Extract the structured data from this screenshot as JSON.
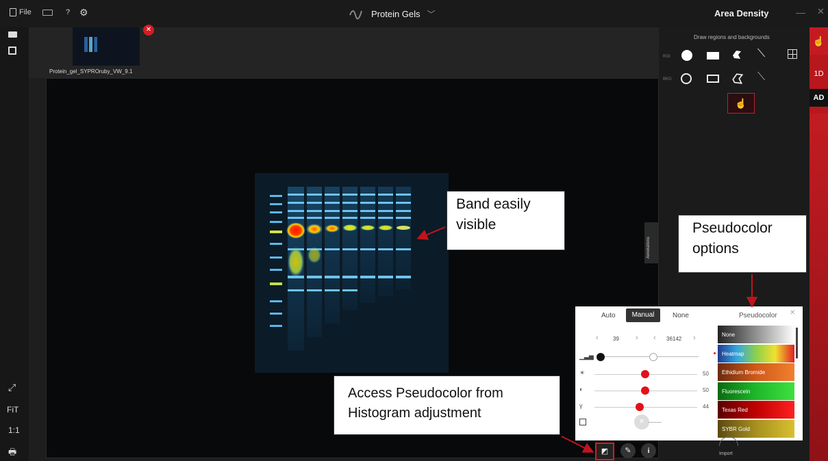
{
  "titlebar": {
    "file_label": "File",
    "help_label": "?",
    "app_title": "Protein Gels",
    "mode_title": "Area Density",
    "minimize": "—",
    "close": "✕"
  },
  "thumbnail": {
    "filename": "Protein_gel_SYPROruby_VW_9.1"
  },
  "left_toolbar": {
    "fit_label": "FiT",
    "one_to_one_label": "1:1"
  },
  "annotations_tab": "Annotations",
  "right_panel": {
    "header": "Draw regions and backgrounds",
    "roi_label": "ROI",
    "bkg_label": "BKG"
  },
  "right_bar": {
    "tab_1d": "1D",
    "tab_ad": "AD"
  },
  "histogram": {
    "tabs": [
      "Auto",
      "Manual",
      "None"
    ],
    "active_tab": "Manual",
    "min_value": "39",
    "max_value": "36142",
    "brightness": "50",
    "contrast": "50",
    "gamma": "44",
    "gamma_symbol": "γ",
    "pseudocolor_title": "Pseudocolor",
    "pseudocolor_options": [
      {
        "name": "None",
        "gradient": "linear-gradient(90deg,#222,#fff)"
      },
      {
        "name": "Heatmap",
        "gradient": "linear-gradient(90deg,#203a8c,#35a6e0,#8ed04a,#f0e030,#e02020)"
      },
      {
        "name": "Ethidium Bromide",
        "gradient": "linear-gradient(90deg,#6b2a10,#d15a18,#f08030)"
      },
      {
        "name": "Fluorescein",
        "gradient": "linear-gradient(90deg,#0a6a10,#1eb82a,#40e040)"
      },
      {
        "name": "Texas Red",
        "gradient": "linear-gradient(90deg,#5a0000,#c00000,#ff2020)"
      },
      {
        "name": "SYBR Gold",
        "gradient": "linear-gradient(90deg,#5a4a10,#a89020,#d8c030)"
      }
    ],
    "selected_option": "Heatmap"
  },
  "bottom": {
    "import_label": "Import",
    "info_label": "i"
  },
  "callouts": {
    "band": "Band easily visible",
    "pseudocolor": "Pseudocolor options",
    "access": "Access Pseudocolor from Histogram adjustment"
  },
  "colors": {
    "accent_red": "#d21d24",
    "heatmap_red": "#e2111a"
  }
}
